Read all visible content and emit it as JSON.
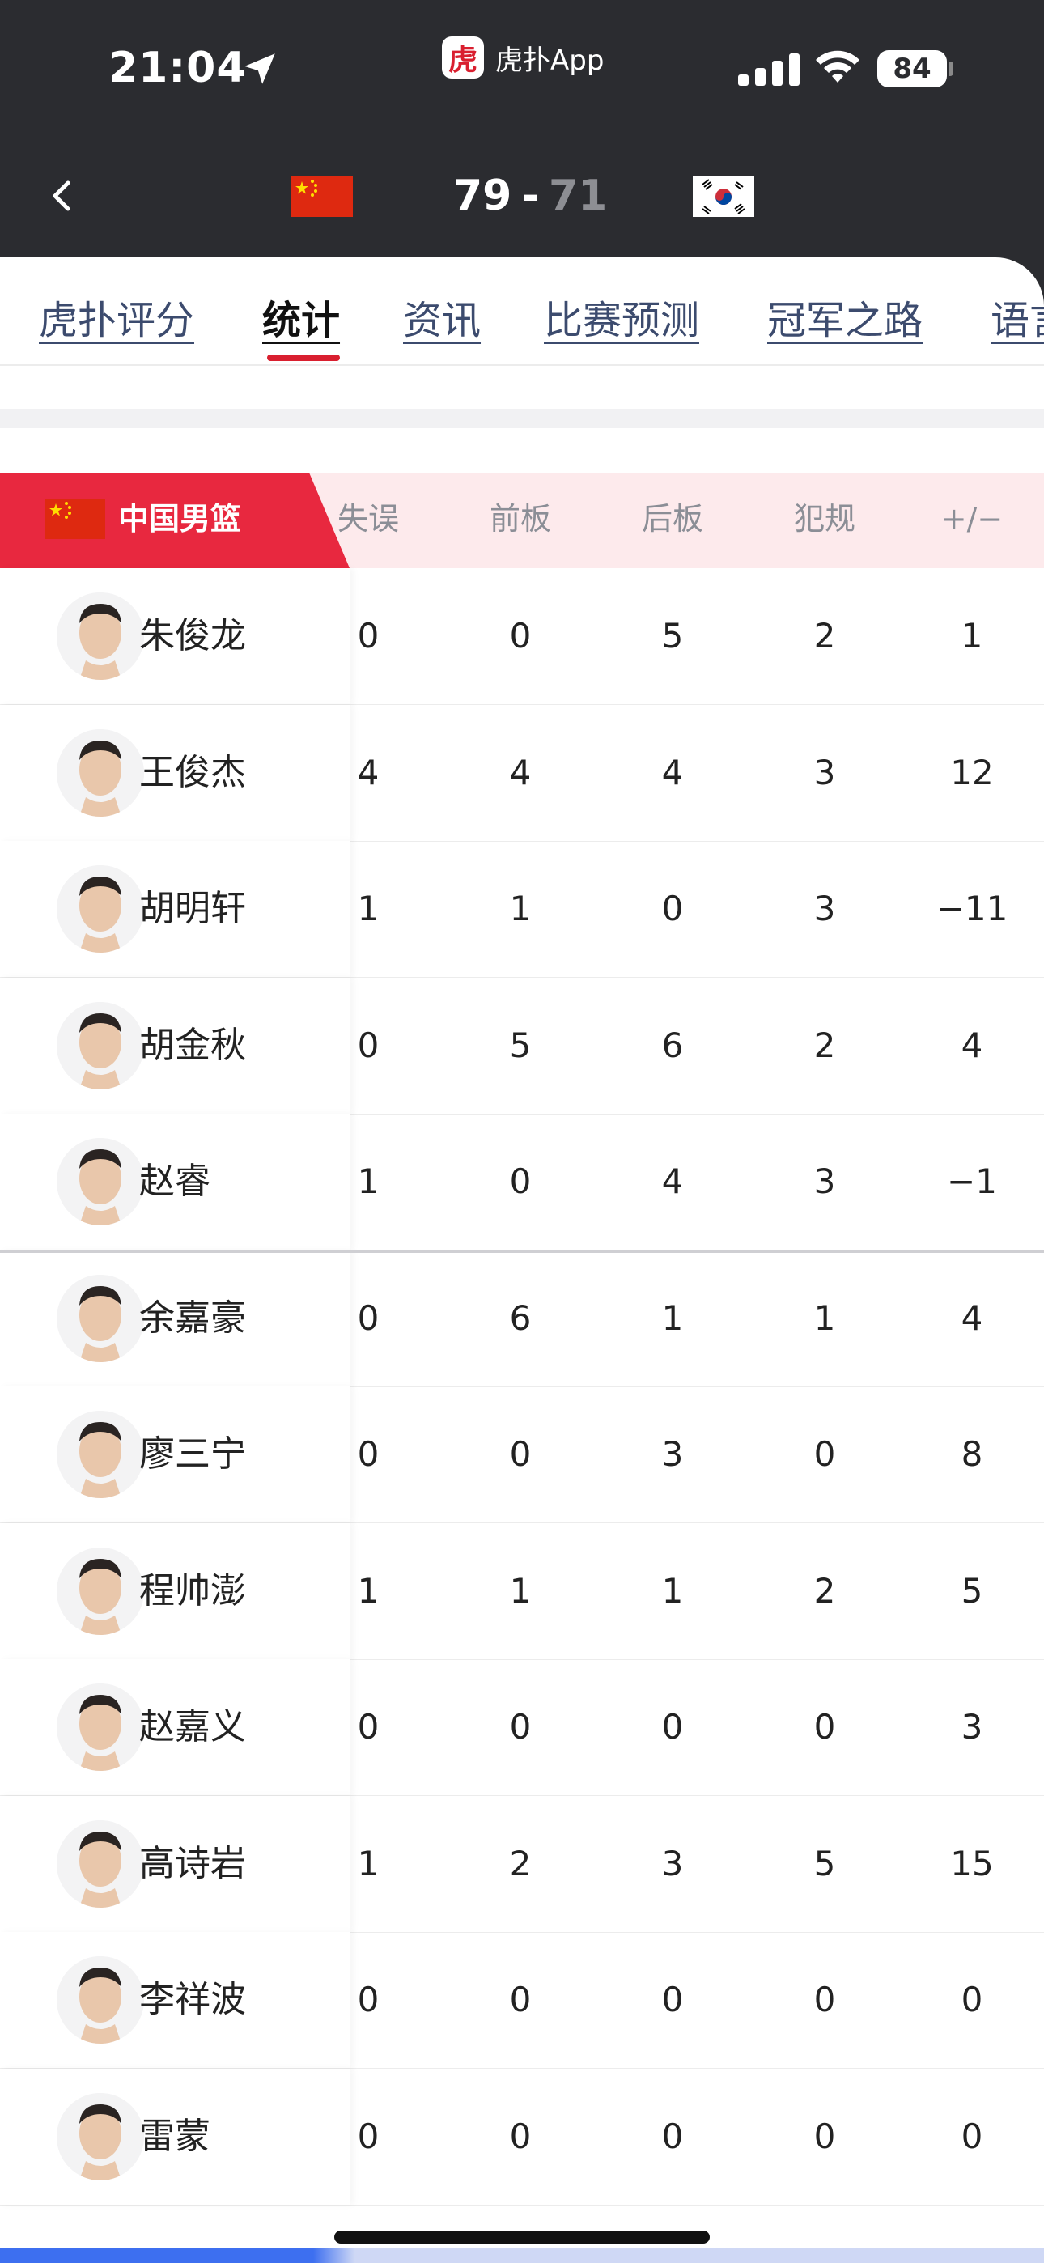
{
  "status_bar": {
    "time": "21:04",
    "app_name": "虎扑App",
    "app_logo": "虎扑",
    "battery": "84",
    "icons": [
      "location-arrow-icon",
      "signal-icon",
      "wifi-icon",
      "battery-icon"
    ]
  },
  "game": {
    "home_score": "79",
    "separator": "-",
    "away_score": "71",
    "home_flag": "china-flag",
    "away_flag": "korea-flag"
  },
  "tabs": [
    "虎扑评分",
    "统计",
    "资讯",
    "比赛预测",
    "冠军之路",
    "语言"
  ],
  "active_tab": "统计",
  "table": {
    "team_name": "中国男篮",
    "columns": [
      "失误",
      "前板",
      "后板",
      "犯规",
      "+/−"
    ],
    "rows": [
      {
        "name": "朱俊龙",
        "stats": [
          "0",
          "0",
          "5",
          "2",
          "1"
        ]
      },
      {
        "name": "王俊杰",
        "stats": [
          "4",
          "4",
          "4",
          "3",
          "12"
        ]
      },
      {
        "name": "胡明轩",
        "stats": [
          "1",
          "1",
          "0",
          "3",
          "−11"
        ]
      },
      {
        "name": "胡金秋",
        "stats": [
          "0",
          "5",
          "6",
          "2",
          "4"
        ]
      },
      {
        "name": "赵睿",
        "stats": [
          "1",
          "0",
          "4",
          "3",
          "−1"
        ]
      },
      {
        "name": "余嘉豪",
        "stats": [
          "0",
          "6",
          "1",
          "1",
          "4"
        ]
      },
      {
        "name": "廖三宁",
        "stats": [
          "0",
          "0",
          "3",
          "0",
          "8"
        ]
      },
      {
        "name": "程帅澎",
        "stats": [
          "1",
          "1",
          "1",
          "2",
          "5"
        ]
      },
      {
        "name": "赵嘉义",
        "stats": [
          "0",
          "0",
          "0",
          "0",
          "3"
        ]
      },
      {
        "name": "高诗岩",
        "stats": [
          "1",
          "2",
          "3",
          "5",
          "15"
        ]
      },
      {
        "name": "李祥波",
        "stats": [
          "0",
          "0",
          "0",
          "0",
          "0"
        ]
      },
      {
        "name": "雷蒙",
        "stats": [
          "0",
          "0",
          "0",
          "0",
          "0"
        ]
      }
    ]
  },
  "colors": {
    "header_dark": "#2b2c30",
    "accent_red": "#e8283f",
    "header_pink": "#fdeaec",
    "tab_link": "#3c4b6e"
  }
}
